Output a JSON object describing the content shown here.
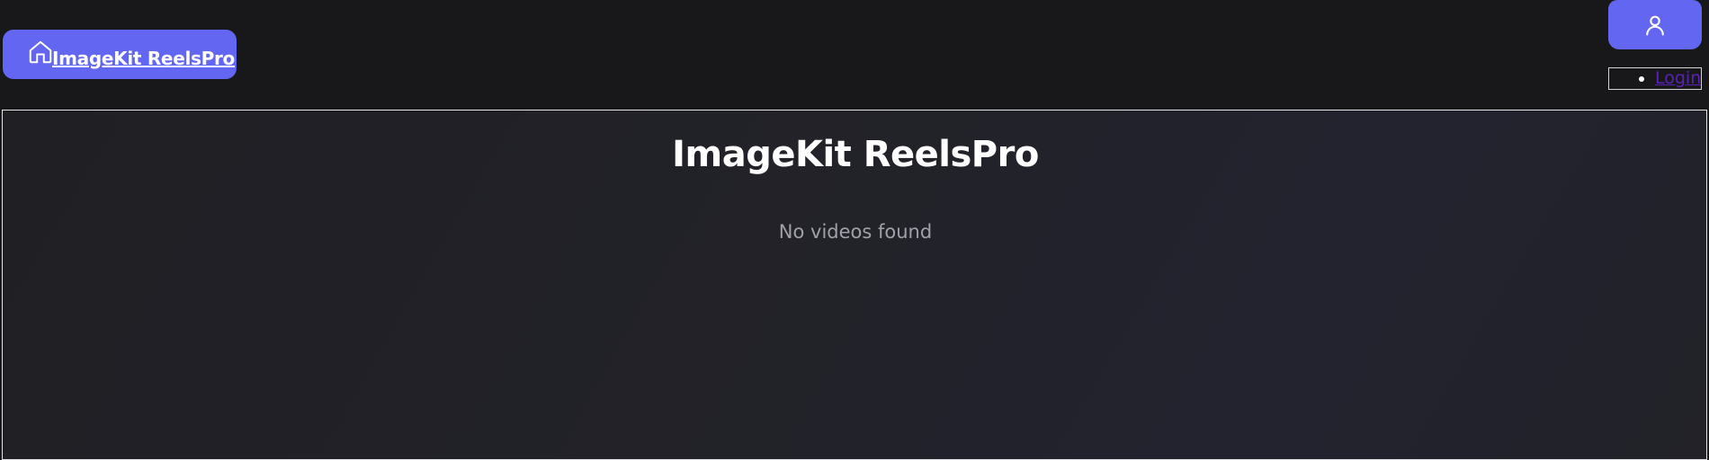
{
  "header": {
    "home_button_label": "ImageKit ReelsPro",
    "home_icon": "home-icon",
    "user_icon": "user-icon",
    "menu": {
      "items": [
        {
          "label": "Login"
        }
      ]
    }
  },
  "main": {
    "title": "ImageKit ReelsPro",
    "empty_message": "No videos found"
  },
  "colors": {
    "accent": "#6366f1",
    "background": "#18181b",
    "link": "#5b21b6"
  }
}
